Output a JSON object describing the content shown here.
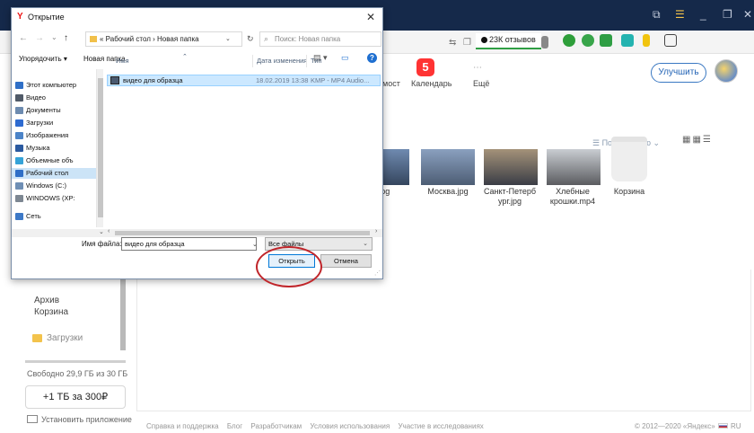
{
  "dialog": {
    "title": "Открытие",
    "close": "✕",
    "nav": {
      "back": "←",
      "forward": "→",
      "dropdown": "⌄",
      "up": "↑",
      "breadcrumb": "« Рабочий стол › Новая папка",
      "search_placeholder": "Поиск: Новая папка"
    },
    "toolbar": {
      "organize": "Упорядочить ▾",
      "new_folder": "Новая папка"
    },
    "nav_pane": [
      {
        "label": "Этот компьютер",
        "color": "#2f6fc7"
      },
      {
        "label": "Видео",
        "color": "#505a68"
      },
      {
        "label": "Документы",
        "color": "#6d8bb0"
      },
      {
        "label": "Загрузки",
        "color": "#2e6bd1"
      },
      {
        "label": "Изображения",
        "color": "#4c84c8"
      },
      {
        "label": "Музыка",
        "color": "#2b5aa0"
      },
      {
        "label": "Объемные объ",
        "color": "#35a3d8"
      },
      {
        "label": "Рабочий стол",
        "color": "#2f6fc7",
        "selected": true
      },
      {
        "label": "Windows (C:)",
        "color": "#6f8fb5"
      },
      {
        "label": "WINDOWS (XP:",
        "color": "#7d8792"
      },
      {
        "label": "Сеть",
        "color": "#3d79c7"
      }
    ],
    "columns": {
      "name": "Имя",
      "date": "Дата изменения",
      "type": "Тип"
    },
    "files": [
      {
        "name": "видео для образца",
        "date": "18.02.2019 13:38",
        "type": "KMP - MP4 Audio..."
      }
    ],
    "file_name_label": "Имя файла:",
    "file_name_value": "видео для образца",
    "filter": "Все файлы",
    "open_button": "Открыть",
    "cancel_button": "Отмена"
  },
  "browser": {
    "reviews": "23К отзывов"
  },
  "disk": {
    "apps": [
      {
        "label": "мост"
      },
      {
        "label": "Календарь",
        "badge": "5"
      },
      {
        "label": "Ещё"
      }
    ],
    "upgrade_button": "Улучшить",
    "sort_label": "☰ По названию ⌄",
    "files": [
      {
        "caption": ".jpg"
      },
      {
        "caption": "Москва.jpg"
      },
      {
        "caption": "Санкт-Петерб ург.jpg"
      },
      {
        "caption": "Хлебные крошки.mp4"
      },
      {
        "caption": "Корзина"
      }
    ],
    "sidebar": {
      "archive": "Архив",
      "trash": "Корзина",
      "downloads": "Загрузки",
      "storage": "Свободно 29,9 ГБ из 30 ГБ",
      "buy": "+1 ТБ за 300₽",
      "install_app": "Установить приложение"
    },
    "footer": {
      "links": [
        "Справка и поддержка",
        "Блог",
        "Разработчикам",
        "Условия использования",
        "Участие в исследованиях"
      ],
      "copyright": "© 2012—2020 «Яндекс»",
      "lang": "RU"
    }
  },
  "colors": {
    "titlebar": "#15294a",
    "accent": "#0078d7",
    "selection": "#cce8ff",
    "highlight_circle": "#c0252a"
  }
}
